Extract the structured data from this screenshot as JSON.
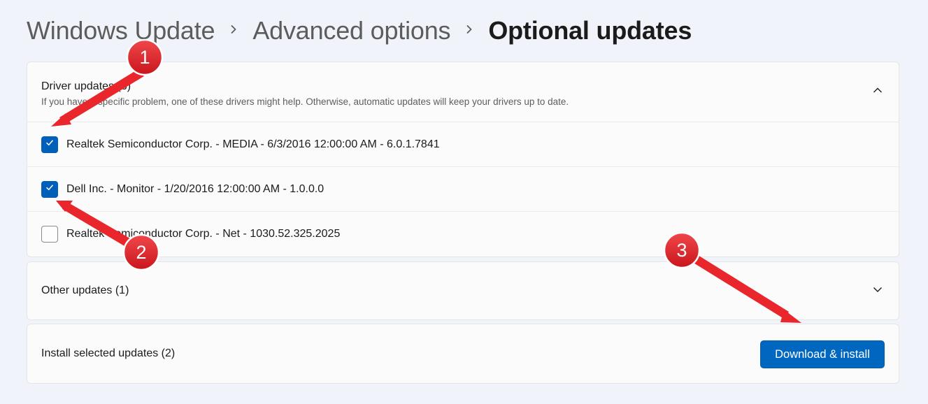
{
  "breadcrumb": {
    "items": [
      "Windows Update",
      "Advanced options",
      "Optional updates"
    ]
  },
  "driver_updates": {
    "title": "Driver updates (3)",
    "description": "If you have a specific problem, one of these drivers might help. Otherwise, automatic updates will keep your drivers up to date.",
    "expanded": true,
    "items": [
      {
        "label": "Realtek Semiconductor Corp. - MEDIA - 6/3/2016 12:00:00 AM - 6.0.1.7841",
        "checked": true
      },
      {
        "label": "Dell Inc. - Monitor - 1/20/2016 12:00:00 AM - 1.0.0.0",
        "checked": true
      },
      {
        "label": "Realtek Semiconductor Corp. - Net - 1030.52.325.2025",
        "checked": false
      }
    ]
  },
  "other_updates": {
    "title": "Other updates (1)",
    "expanded": false
  },
  "install": {
    "label": "Install selected updates (2)",
    "button_label": "Download & install"
  },
  "annotations": {
    "badges": [
      "1",
      "2",
      "3"
    ]
  },
  "colors": {
    "accent": "#005fb8",
    "button": "#0067c0",
    "annotation": "#e8262c",
    "background": "#f0f3f9"
  },
  "icons": {
    "breadcrumb_separator": "chevron-right-icon",
    "driver_toggle": "chevron-up-icon",
    "other_toggle": "chevron-down-icon",
    "checkbox_mark": "checkmark-icon"
  }
}
